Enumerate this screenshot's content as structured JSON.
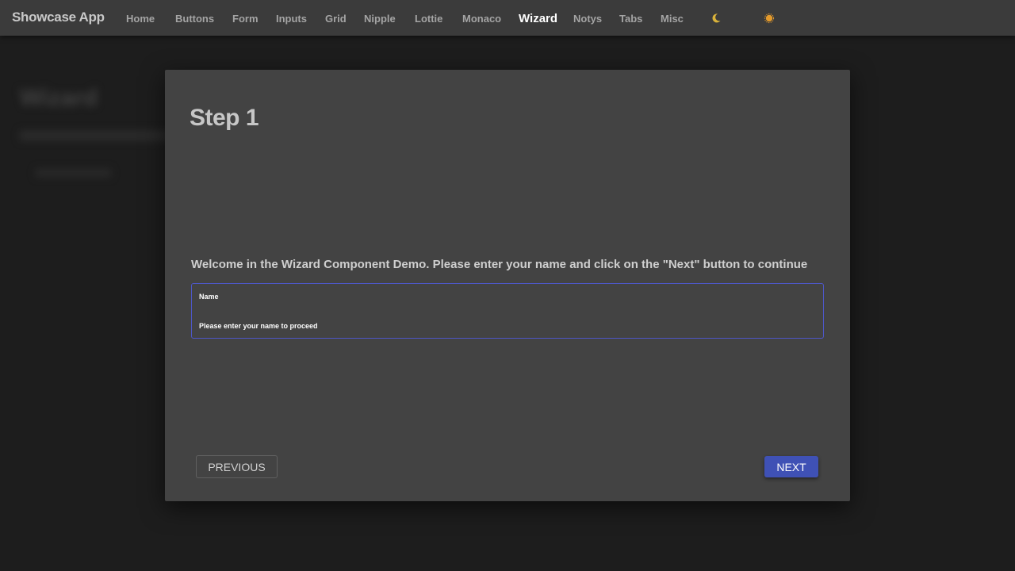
{
  "navbar": {
    "brand": "Showcase App",
    "items": [
      {
        "label": "Home"
      },
      {
        "label": "Buttons"
      },
      {
        "label": "Form"
      },
      {
        "label": "Inputs"
      },
      {
        "label": "Grid"
      },
      {
        "label": "Nipple"
      },
      {
        "label": "Lottie"
      },
      {
        "label": "Monaco"
      },
      {
        "label": "Wizard",
        "active": true
      },
      {
        "label": "Notys"
      },
      {
        "label": "Tabs"
      },
      {
        "label": "Misc"
      }
    ],
    "theme_icons": [
      "moon-icon",
      "sun-icon"
    ]
  },
  "background_page": {
    "title": "Wizard"
  },
  "wizard": {
    "step_title": "Step 1",
    "welcome_text": "Welcome in the Wizard Component Demo. Please enter your name and click on the \"Next\" button to continue",
    "name_field": {
      "label": "Name",
      "value": "",
      "helper": "Please enter your name to proceed"
    },
    "previous_label": "PREVIOUS",
    "next_label": "NEXT"
  },
  "colors": {
    "accent": "#3f51b5",
    "navbar_bg": "#3b3b3b",
    "modal_bg": "#434343",
    "page_bg": "#222222"
  }
}
